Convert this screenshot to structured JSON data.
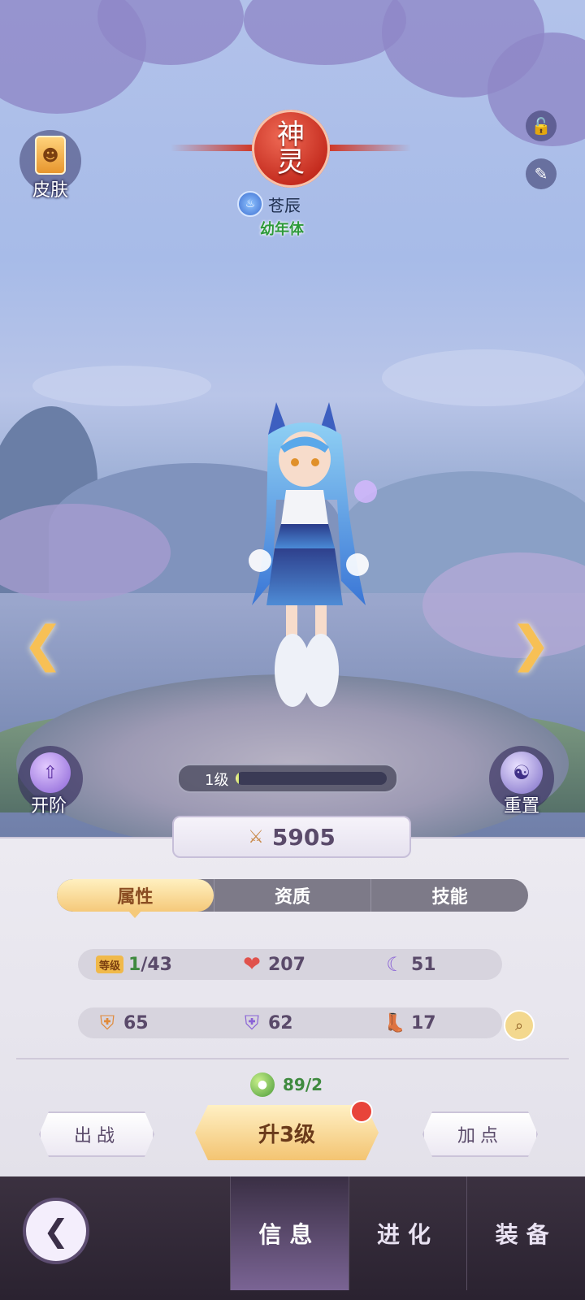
{
  "header": {
    "rank_char1": "神",
    "rank_char2": "灵",
    "element_icon": "flame-icon",
    "name": "苍辰",
    "stage": "幼年体"
  },
  "left_top": {
    "skin_label": "皮肤",
    "skin_icon": "cat-card-icon"
  },
  "right_top": {
    "lock_icon": "unlock-icon",
    "brush_icon": "brush-icon"
  },
  "side": {
    "upgrade_label": "开阶",
    "reset_label": "重置"
  },
  "level_bar": {
    "label": "1级",
    "progress": 0.02
  },
  "power": {
    "value": "5905",
    "icon": "sword-icon"
  },
  "tabs": [
    {
      "label": "属性",
      "active": true
    },
    {
      "label": "资质",
      "active": false
    },
    {
      "label": "技能",
      "active": false
    }
  ],
  "stats_row1": {
    "level_badge": "等级",
    "level_current": "1",
    "level_max": "/43",
    "hp": "207",
    "magic": "51"
  },
  "stats_row2": {
    "defense": "65",
    "magic_defense": "62",
    "speed": "17"
  },
  "exp": {
    "value": "89/2",
    "icon": "exp-orb-icon"
  },
  "actions": {
    "deploy": "出战",
    "level_up": "升3级",
    "add_points": "加点"
  },
  "bottom_nav": [
    {
      "label": "信息",
      "active": true
    },
    {
      "label": "进化",
      "active": false
    },
    {
      "label": "装备",
      "active": false
    }
  ],
  "colors": {
    "accent_gold": "#f5c97a",
    "rank_red": "#c42b1e",
    "green_text": "#3f8a3f"
  }
}
